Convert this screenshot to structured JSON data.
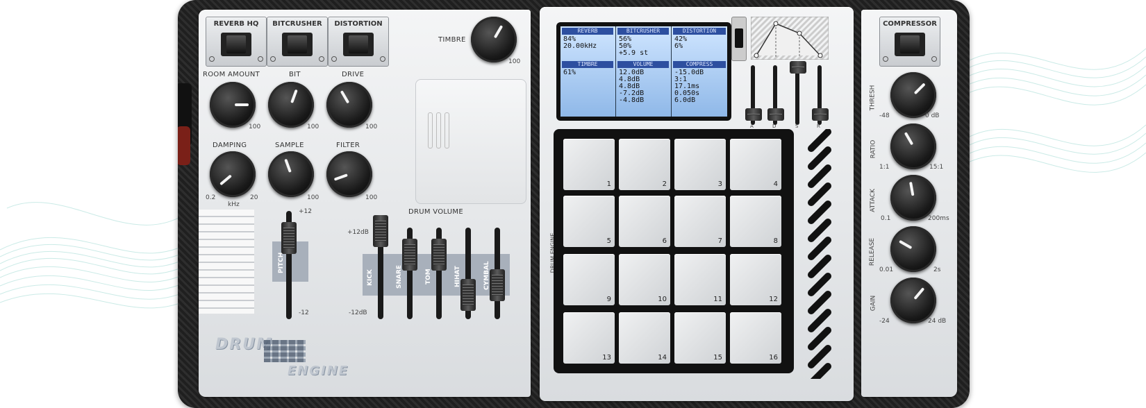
{
  "effects": {
    "switches": [
      "REVERB HQ",
      "BITCRUSHER",
      "DISTORTION"
    ],
    "knob_rows": [
      [
        {
          "label": "ROOM AMOUNT",
          "min": "",
          "max": "100"
        },
        {
          "label": "BIT",
          "min": "",
          "max": "100"
        },
        {
          "label": "DRIVE",
          "min": "",
          "max": "100"
        }
      ],
      [
        {
          "label": "DAMPING",
          "min": "0.2",
          "max": "20",
          "unit": "kHz"
        },
        {
          "label": "SAMPLE",
          "min": "",
          "max": "100"
        },
        {
          "label": "FILTER",
          "min": "",
          "max": "100"
        }
      ]
    ]
  },
  "timbre": {
    "label": "TIMBRE",
    "max": "100"
  },
  "pitch": {
    "label": "PITCH",
    "max": "+12",
    "min": "-12"
  },
  "drum_volume": {
    "title": "DRUM VOLUME",
    "max": "+12dB",
    "min": "-12dB",
    "channels": [
      "KICK",
      "SNARE",
      "TOM",
      "HIHAT",
      "CYMBAL"
    ]
  },
  "brand": {
    "line1": "DRUM",
    "line2": "ENGINE",
    "side": "DRUM ENGINE"
  },
  "display": {
    "top_headers": [
      "REVERB",
      "BITCRUSHER",
      "DISTORTION"
    ],
    "top_values": [
      "84%\n20.00kHz",
      "56%\n50%\n+5.9 st",
      "42%\n6%"
    ],
    "bottom_headers": [
      "TIMBRE",
      "VOLUME",
      "COMPRESS"
    ],
    "bottom_values": [
      "61%",
      "12.0dB\n4.8dB\n4.8dB\n-7.2dB\n-4.8dB",
      "-15.0dB\n3:1\n17.1ms\n0.050s\n6.0dB"
    ]
  },
  "envelope": {
    "sliders": [
      "A",
      "D",
      "S",
      "R"
    ]
  },
  "pads": [
    "1",
    "2",
    "3",
    "4",
    "5",
    "6",
    "7",
    "8",
    "9",
    "10",
    "11",
    "12",
    "13",
    "14",
    "15",
    "16"
  ],
  "compressor": {
    "title": "COMPRESSOR",
    "knobs": [
      {
        "label": "THRESH",
        "min": "-48",
        "max": "0 dB"
      },
      {
        "label": "RATIO",
        "min": "1:1",
        "max": "15:1"
      },
      {
        "label": "ATTACK",
        "min": "0.1",
        "max": "200ms"
      },
      {
        "label": "RELEASE",
        "min": "0.01",
        "max": "2s"
      },
      {
        "label": "GAIN",
        "min": "-24",
        "max": "24 dB"
      }
    ]
  }
}
